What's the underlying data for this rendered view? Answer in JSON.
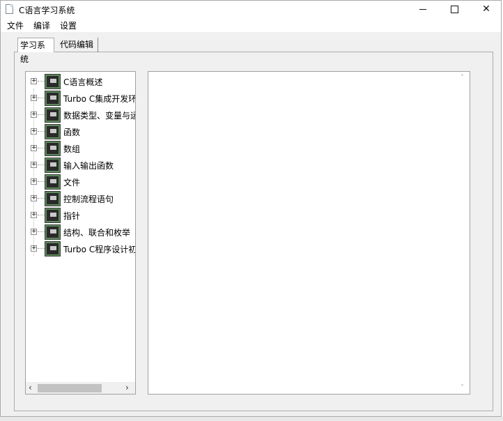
{
  "window": {
    "title": "C语言学习系统"
  },
  "menu": {
    "items": [
      "文件",
      "编译",
      "设置"
    ]
  },
  "tabs": [
    {
      "label": "学习系统",
      "active": true
    },
    {
      "label": "代码编辑",
      "active": false
    }
  ],
  "tree": {
    "items": [
      {
        "label": "C语言概述"
      },
      {
        "label": "Turbo C集成开发环"
      },
      {
        "label": "数据类型、变量与运"
      },
      {
        "label": "函数"
      },
      {
        "label": "数组"
      },
      {
        "label": "输入输出函数"
      },
      {
        "label": "文件"
      },
      {
        "label": "控制流程语句"
      },
      {
        "label": "指针"
      },
      {
        "label": "结构、联合和枚举"
      },
      {
        "label": "Turbo C程序设计初"
      }
    ],
    "expander_glyph": "+"
  },
  "colors": {
    "window_bg": "#f0f0f0",
    "node_icon": "#5c8a5a"
  }
}
